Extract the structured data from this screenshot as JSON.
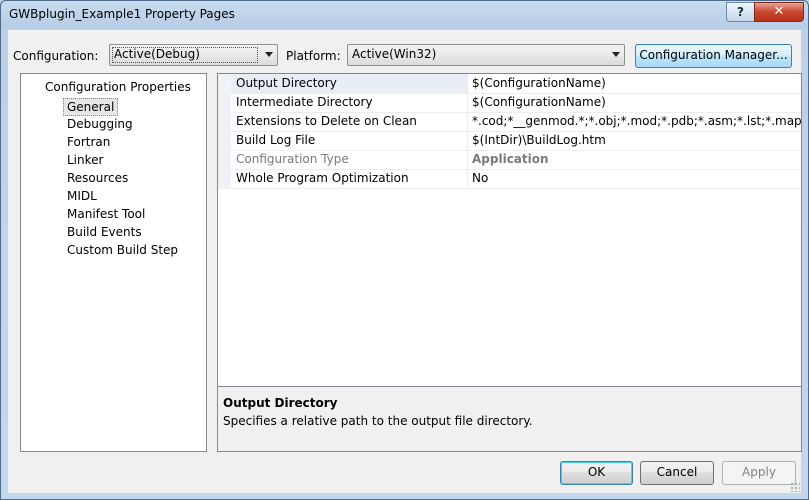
{
  "window": {
    "title": "GWBplugin_Example1 Property Pages"
  },
  "titlebar": {
    "help_glyph": "?",
    "close_glyph": "✕"
  },
  "config": {
    "configuration_label": "Configuration:",
    "configuration_value": "Active(Debug)",
    "platform_label": "Platform:",
    "platform_value": "Active(Win32)",
    "manager_button": "Configuration Manager..."
  },
  "tree": {
    "root": "Configuration Properties",
    "items": [
      "General",
      "Debugging",
      "Fortran",
      "Linker",
      "Resources",
      "MIDL",
      "Manifest Tool",
      "Build Events",
      "Custom Build Step"
    ],
    "selected": "General"
  },
  "grid": {
    "rows": [
      {
        "name": "Output Directory",
        "value": "$(ConfigurationName)"
      },
      {
        "name": "Intermediate Directory",
        "value": "$(ConfigurationName)"
      },
      {
        "name": "Extensions to Delete on Clean",
        "value": "*.cod;*__genmod.*;*.obj;*.mod;*.pdb;*.asm;*.lst;*.map;*.dyn;*"
      },
      {
        "name": "Build Log File",
        "value": "$(IntDir)\\BuildLog.htm"
      },
      {
        "name": "Configuration Type",
        "value": "Application"
      },
      {
        "name": "Whole Program Optimization",
        "value": "No"
      }
    ]
  },
  "description": {
    "title": "Output Directory",
    "text": "Specifies a relative path to the output file directory."
  },
  "buttons": {
    "ok": "OK",
    "cancel": "Cancel",
    "apply": "Apply"
  }
}
